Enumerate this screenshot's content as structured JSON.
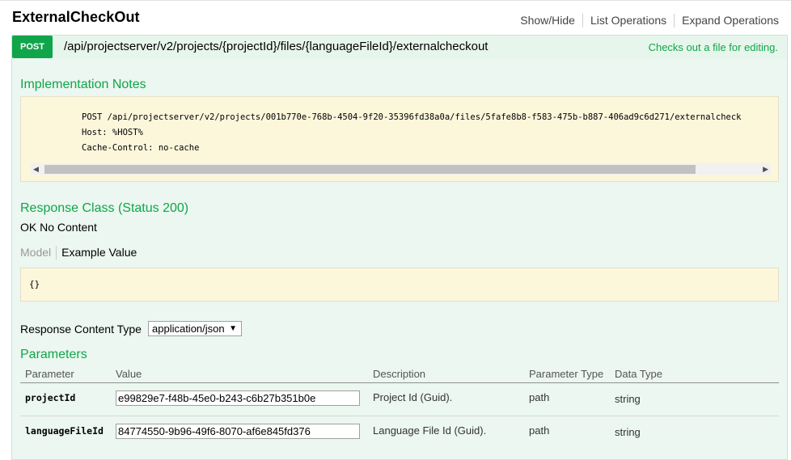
{
  "header": {
    "title": "ExternalCheckOut",
    "show_hide": "Show/Hide",
    "list_operations": "List Operations",
    "expand_operations": "Expand Operations"
  },
  "operation": {
    "method": "POST",
    "path": "/api/projectserver/v2/projects/{projectId}/files/{languageFileId}/externalcheckout",
    "summary": "Checks out a file for editing."
  },
  "implementation": {
    "title": "Implementation Notes",
    "code_line1": "POST /api/projectserver/v2/projects/001b770e-768b-4504-9f20-35396fd38a0a/files/5fafe8b8-f583-475b-b887-406ad9c6d271/externalcheck",
    "code_line2": "Host: %HOST%",
    "code_line3": "Cache-Control: no-cache",
    "scroll_left_icon": "◀",
    "scroll_right_icon": "▶"
  },
  "response": {
    "title": "Response Class (Status 200)",
    "description": "OK No Content",
    "model_tab": "Model",
    "example_tab": "Example Value",
    "example_value": "{}",
    "content_type_label": "Response Content Type",
    "content_type_value": "application/json",
    "content_type_caret": "▼"
  },
  "parameters": {
    "title": "Parameters",
    "columns": {
      "parameter": "Parameter",
      "value": "Value",
      "description": "Description",
      "parameter_type": "Parameter Type",
      "data_type": "Data Type"
    },
    "rows": [
      {
        "name": "projectId",
        "value": "e99829e7-f48b-45e0-b243-c6b27b351b0e",
        "description": "Project Id (Guid).",
        "param_type": "path",
        "data_type": "string"
      },
      {
        "name": "languageFileId",
        "value": "84774550-9b96-49f6-8070-af6e845fd376",
        "description": "Language File Id (Guid).",
        "param_type": "path",
        "data_type": "string"
      }
    ]
  },
  "colors": {
    "accent_green": "#10a54a",
    "panel_bg": "#ebf7f0",
    "code_bg": "#fcf6db"
  }
}
